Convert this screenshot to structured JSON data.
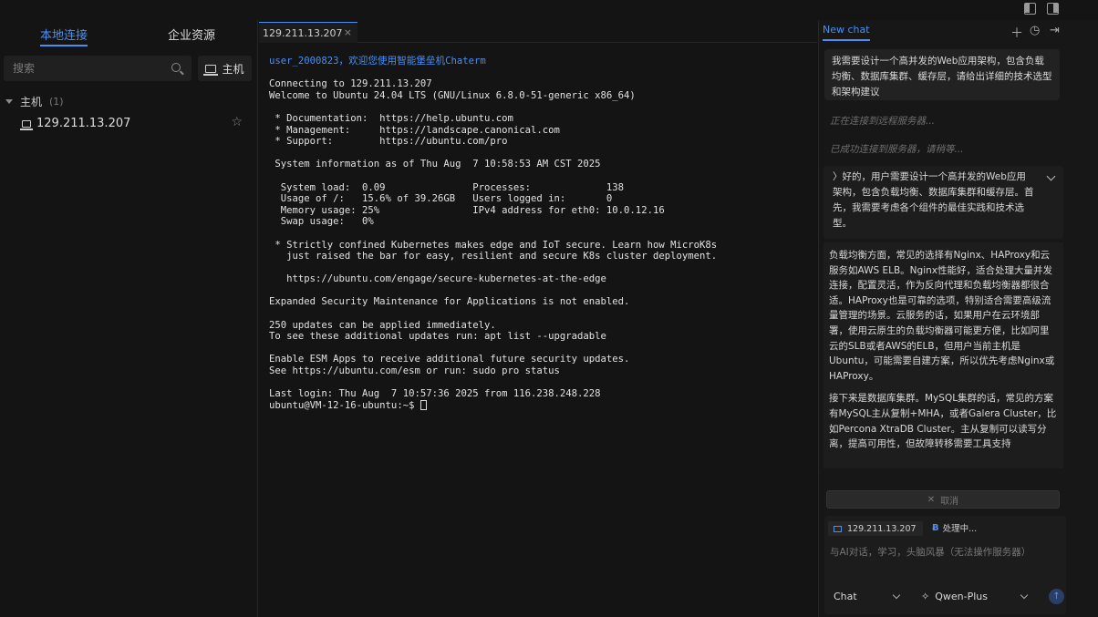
{
  "sidebar": {
    "tabs": [
      {
        "label": "本地连接"
      },
      {
        "label": "企业资源"
      }
    ],
    "search_placeholder": "搜索",
    "host_button_label": "主机",
    "group": {
      "label": "主机",
      "count": "(1)"
    },
    "hosts": [
      {
        "label": "129.211.13.207"
      }
    ]
  },
  "terminal": {
    "tab_label": "129.211.13.207",
    "welcome": "user_2000823，欢迎您使用智能堡垒机Chaterm",
    "lines": [
      "",
      "Connecting to 129.211.13.207",
      "Welcome to Ubuntu 24.04 LTS (GNU/Linux 6.8.0-51-generic x86_64)",
      "",
      " * Documentation:  https://help.ubuntu.com",
      " * Management:     https://landscape.canonical.com",
      " * Support:        https://ubuntu.com/pro",
      "",
      " System information as of Thu Aug  7 10:58:53 AM CST 2025",
      "",
      "  System load:  0.09               Processes:             138",
      "  Usage of /:   15.6% of 39.26GB   Users logged in:       0",
      "  Memory usage: 25%                IPv4 address for eth0: 10.0.12.16",
      "  Swap usage:   0%",
      "",
      " * Strictly confined Kubernetes makes edge and IoT secure. Learn how MicroK8s",
      "   just raised the bar for easy, resilient and secure K8s cluster deployment.",
      "",
      "   https://ubuntu.com/engage/secure-kubernetes-at-the-edge",
      "",
      "Expanded Security Maintenance for Applications is not enabled.",
      "",
      "250 updates can be applied immediately.",
      "To see these additional updates run: apt list --upgradable",
      "",
      "Enable ESM Apps to receive additional future security updates.",
      "See https://ubuntu.com/esm or run: sudo pro status",
      "",
      "Last login: Thu Aug  7 10:57:36 2025 from 116.238.248.228"
    ],
    "prompt": "ubuntu@VM-12-16-ubuntu:~$ "
  },
  "chat": {
    "tab_label": "New chat",
    "user_message": "我需要设计一个高并发的Web应用架构，包含负载均衡、数据库集群、缓存层，请给出详细的技术选型和架构建议",
    "status_connecting": "正在连接到远程服务器...",
    "status_connected": "已成功连接到服务器，请稍等...",
    "thinking_text": "〉好的，用户需要设计一个高并发的Web应用架构，包含负载均衡、数据库集群和缓存层。首先，我需要考虑各个组件的最佳实践和技术选型。",
    "answer_paragraphs": [
      "负载均衡方面，常见的选择有Nginx、HAProxy和云服务如AWS ELB。Nginx性能好，适合处理大量并发连接，配置灵活，作为反向代理和负载均衡器都很合适。HAProxy也是可靠的选项，特别适合需要高级流量管理的场景。云服务的话，如果用户在云环境部署，使用云原生的负载均衡器可能更方便，比如阿里云的SLB或者AWS的ELB，但用户当前主机是Ubuntu，可能需要自建方案，所以优先考虑Nginx或HAProxy。",
      "接下来是数据库集群。MySQL集群的话，常见的方案有MySQL主从复制+MHA，或者Galera Cluster，比如Percona XtraDB Cluster。主从复制可以读写分离，提高可用性，但故障转移需要工具支持"
    ],
    "cancel_label": "取消",
    "host_chip": "129.211.13.207",
    "processing_label": "处理中...",
    "input_placeholder": "与AI对话，学习，头脑风暴（无法操作服务器）",
    "mode": "Chat",
    "model": "Qwen-Plus"
  },
  "colors": {
    "accent": "#4a8ff0",
    "background": "#141414",
    "panel": "#171717"
  }
}
